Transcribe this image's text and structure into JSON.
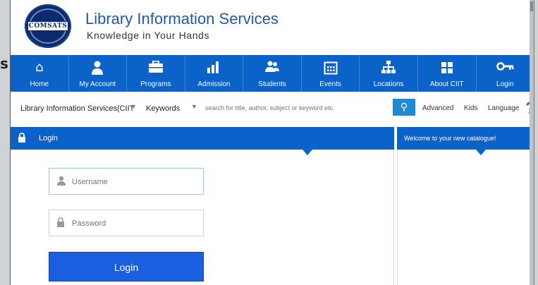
{
  "page": {
    "edge_char": "s"
  },
  "header": {
    "logo_text": "COMSATS",
    "title": "Library Information Services",
    "tagline": "Knowledge in Your Hands"
  },
  "nav": {
    "items": [
      {
        "label": "Home",
        "icon": "home-icon"
      },
      {
        "label": "My Account",
        "icon": "user-icon"
      },
      {
        "label": "Programs",
        "icon": "briefcase-icon"
      },
      {
        "label": "Admission",
        "icon": "bar-chart-icon"
      },
      {
        "label": "Students",
        "icon": "users-icon"
      },
      {
        "label": "Events",
        "icon": "calendar-icon"
      },
      {
        "label": "Locations",
        "icon": "sitemap-icon"
      },
      {
        "label": "About CIIT",
        "icon": "grid-icon"
      },
      {
        "label": "Login",
        "icon": "key-icon"
      }
    ]
  },
  "search": {
    "library_select": "Library Information Services(CIIT",
    "field_select": "Keywords",
    "placeholder": "search for title, author, subject or keyword etc.",
    "advanced": "Advanced",
    "kids": "Kids",
    "language": "Language",
    "help": "?"
  },
  "login_panel": {
    "title": "Login",
    "username_placeholder": "Username",
    "password_placeholder": "Password",
    "button": "Login"
  },
  "welcome": {
    "title": "Welcome to your new catalogue!"
  },
  "colors": {
    "nav_bg": "#0b63c9",
    "title_blue": "#1e5aa8",
    "button_blue": "#1a5fe0"
  }
}
